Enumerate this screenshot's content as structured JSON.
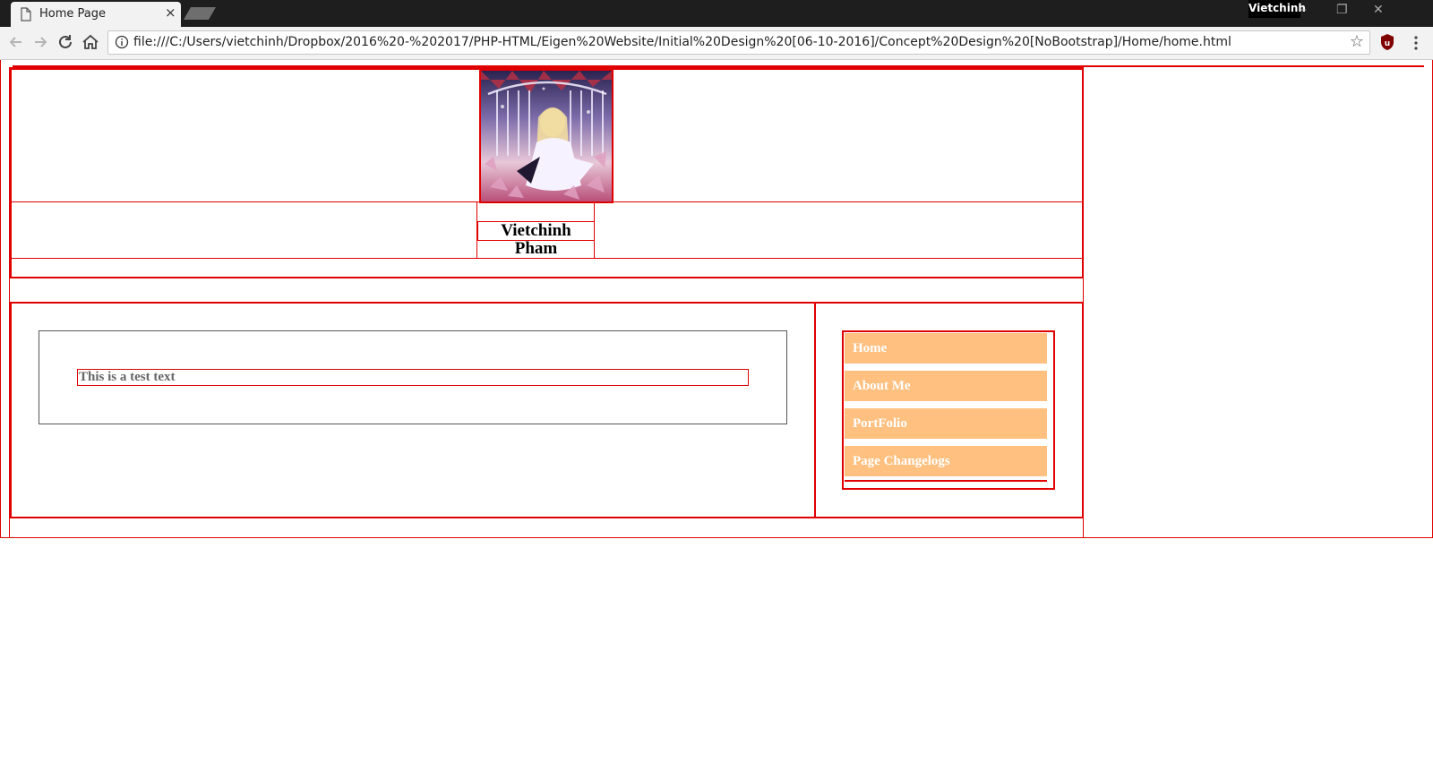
{
  "browser": {
    "tab_title": "Home Page",
    "tab_close": "×",
    "profile_name": "Vietchinh",
    "window_controls": {
      "minimize": "–",
      "restore": "❐",
      "close": "✕"
    },
    "url": "file:///C:/Users/vietchinh/Dropbox/2016%20-%202017/PHP-HTML/Eigen%20Website/Initial%20Design%20[06-10-2016]/Concept%20Design%20[NoBootstrap]/Home/home.html",
    "bookmark_icon": "star-icon",
    "icons": [
      "back-arrow-icon",
      "forward-arrow-icon",
      "reload-icon",
      "home-icon",
      "info-icon",
      "ublock-shield-icon",
      "menu-dots-icon"
    ]
  },
  "page": {
    "site_name": "Vietchinh Pham",
    "content_text": "This is a test text",
    "nav": [
      {
        "label": "Home"
      },
      {
        "label": "About Me"
      },
      {
        "label": "PortFolio"
      },
      {
        "label": "Page Changelogs"
      }
    ],
    "colors": {
      "border": "#e00000",
      "nav_background": "#ffc080",
      "nav_text": "#ffffff"
    }
  }
}
